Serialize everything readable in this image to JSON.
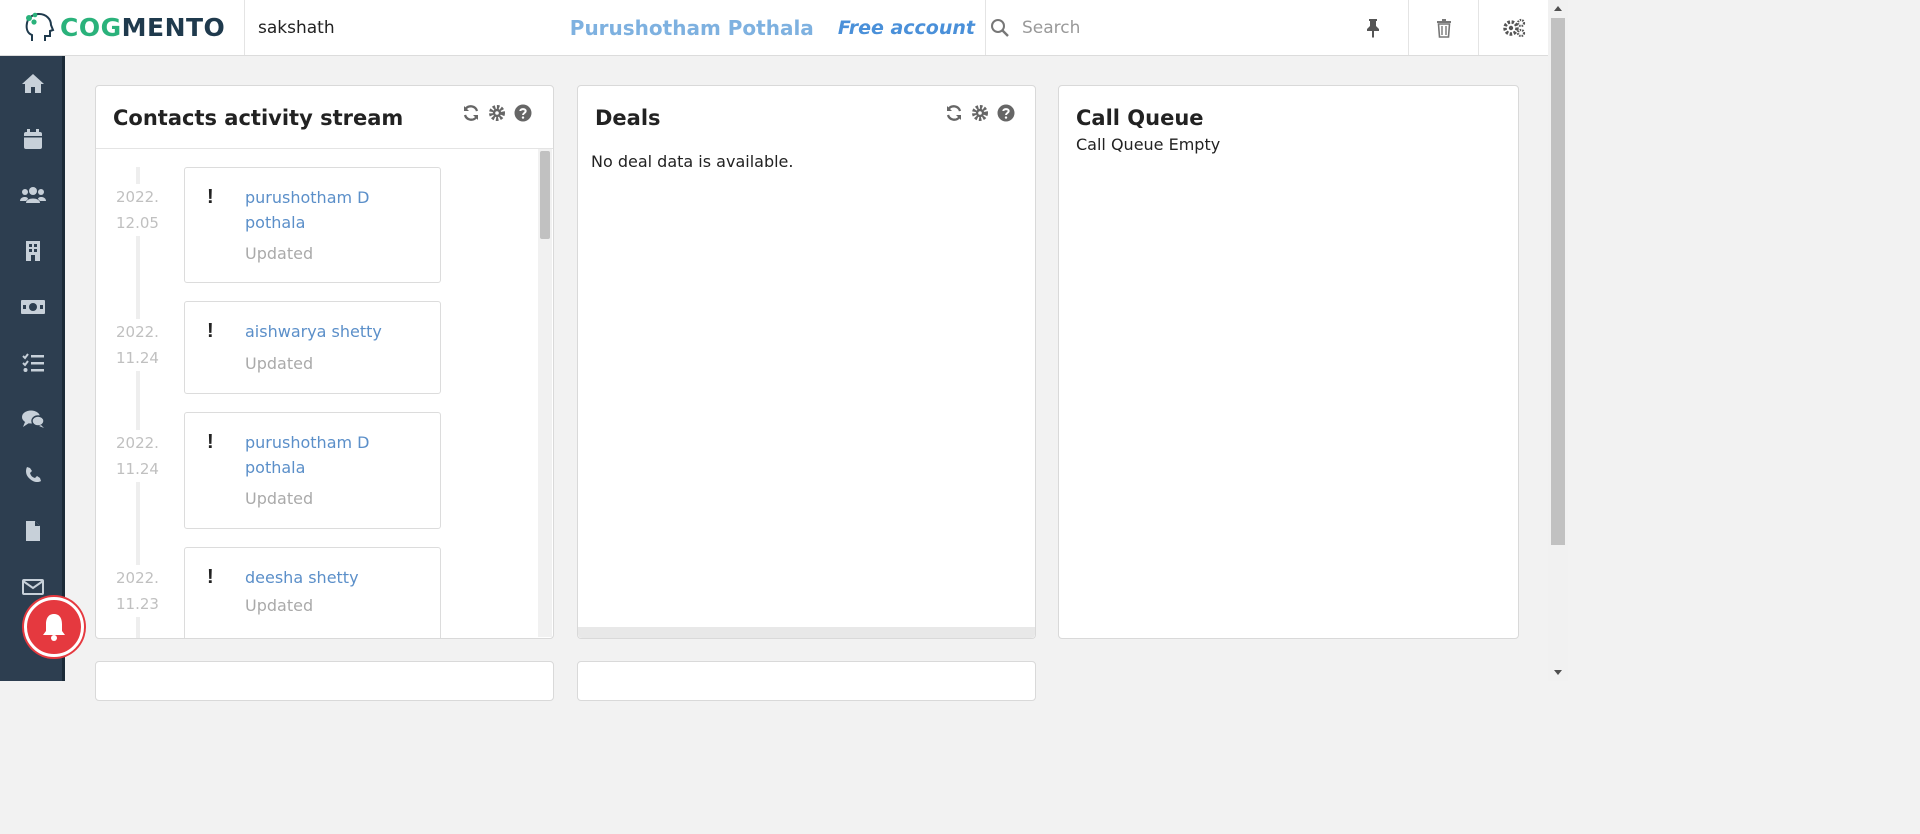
{
  "app": {
    "logo_cog": "COG",
    "logo_mento": "MENTO",
    "workspace": "sakshath",
    "user_name": "Purushotham Pothala",
    "account_type": "Free account"
  },
  "search": {
    "placeholder": "Search"
  },
  "toolbar_icons": [
    "search-icon",
    "pin-icon",
    "trash-icon",
    "settings-icon"
  ],
  "sidebar": {
    "items": [
      {
        "icon": "home-icon"
      },
      {
        "icon": "calendar-icon"
      },
      {
        "icon": "contacts-icon"
      },
      {
        "icon": "companies-icon"
      },
      {
        "icon": "deals-icon"
      },
      {
        "icon": "tasks-icon"
      },
      {
        "icon": "cases-icon"
      },
      {
        "icon": "calls-icon"
      },
      {
        "icon": "documents-icon"
      },
      {
        "icon": "email-icon"
      }
    ]
  },
  "contacts_stream": {
    "title": "Contacts activity stream",
    "entries": [
      {
        "date_year": "2022.",
        "date_day": "12.05",
        "name": "purushotham D pothala",
        "status": "Updated"
      },
      {
        "date_year": "2022.",
        "date_day": "11.24",
        "name": "aishwarya shetty",
        "status": "Updated"
      },
      {
        "date_year": "2022.",
        "date_day": "11.24",
        "name": "purushotham D pothala",
        "status": "Updated"
      },
      {
        "date_year": "2022.",
        "date_day": "11.23",
        "name": "deesha shetty",
        "status": "Updated"
      }
    ]
  },
  "deals": {
    "title": "Deals",
    "empty_message": "No deal data is available."
  },
  "call_queue": {
    "title": "Call Queue",
    "empty_message": "Call Queue Empty"
  },
  "colors": {
    "sidebar_bg": "#2d3e50",
    "accent_green": "#2ab27b",
    "link_blue": "#5b8fc9",
    "notification_red": "#e5393f"
  }
}
